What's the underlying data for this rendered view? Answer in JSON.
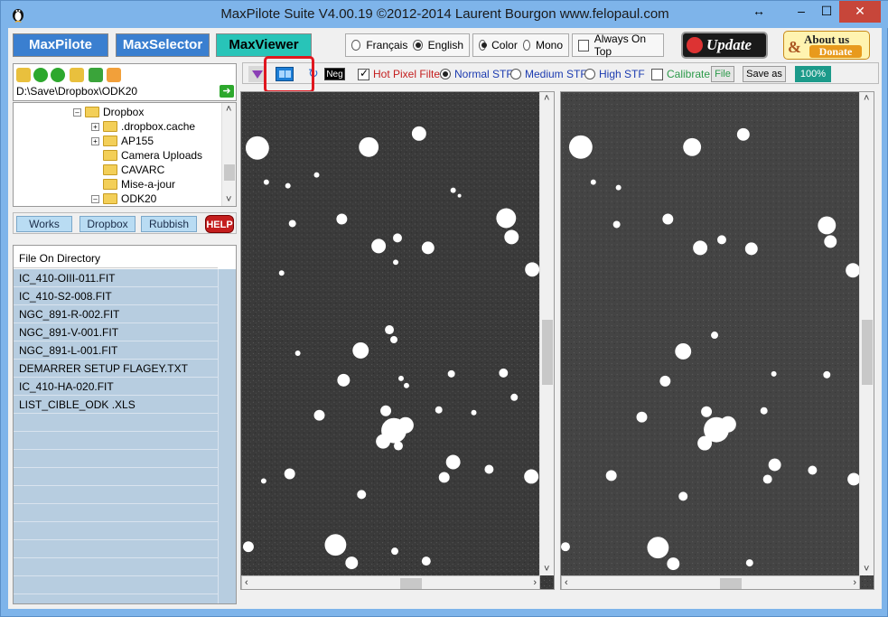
{
  "window": {
    "title": "MaxPilote Suite  V4.00.19  ©2012-2014 Laurent Bourgon  www.felopaul.com",
    "controls": {
      "restore": "↔",
      "minimize": "–",
      "maximize": "☐",
      "close": "✕"
    }
  },
  "topbar": {
    "apps": [
      {
        "label": "MaxPilote",
        "color": "#3a7fd0"
      },
      {
        "label": "MaxSelector",
        "color": "#3a7fd0"
      },
      {
        "label": "MaxViewer",
        "color": "#28c4b8"
      }
    ],
    "language": {
      "options": [
        "Français",
        "English"
      ],
      "selected": "English"
    },
    "colormode": {
      "options": [
        "Color",
        "Mono"
      ],
      "selected": "Color"
    },
    "always_on_top": {
      "label": "Always On Top",
      "checked": false
    },
    "update_label": "Update",
    "about_label": "About us",
    "donate_label": "Donate"
  },
  "browser": {
    "path": "D:\\Save\\Dropbox\\ODK20",
    "go_icon": "arrow-right-icon",
    "tree": [
      {
        "label": "Dropbox",
        "expander": "–",
        "level": 0
      },
      {
        "label": ".dropbox.cache",
        "expander": "+",
        "level": 1
      },
      {
        "label": "AP155",
        "expander": "+",
        "level": 1
      },
      {
        "label": "Camera Uploads",
        "expander": "",
        "level": 1
      },
      {
        "label": "CAVARC",
        "expander": "",
        "level": 1
      },
      {
        "label": "Mise-a-jour",
        "expander": "",
        "level": 1
      },
      {
        "label": "ODK20",
        "expander": "–",
        "level": 1
      }
    ]
  },
  "tabs": {
    "works": "Works",
    "dropbox": "Dropbox",
    "rubbish": "Rubbish",
    "help": "HELP"
  },
  "filelist": {
    "header": "File On Directory",
    "files": [
      "IC_410-OIII-011.FIT",
      "IC_410-S2-008.FIT",
      "NGC_891-R-002.FIT",
      "NGC_891-V-001.FIT",
      "NGC_891-L-001.FIT",
      "DEMARRER SETUP FLAGEY.TXT",
      "IC_410-HA-020.FIT",
      "LIST_CIBLE_ODK  .XLS"
    ]
  },
  "viewer": {
    "neg_label": "Neg",
    "hot_pixel": {
      "label": "Hot Pixel Filter",
      "checked": true
    },
    "stf": {
      "options": [
        "Normal STF",
        "Medium STF",
        "High STF"
      ],
      "selected": "Normal STF"
    },
    "calibrate": {
      "label": "Calibrate",
      "checked": false
    },
    "file_label": "File",
    "saveas_label": "Save as",
    "zoom_label": "100%"
  }
}
